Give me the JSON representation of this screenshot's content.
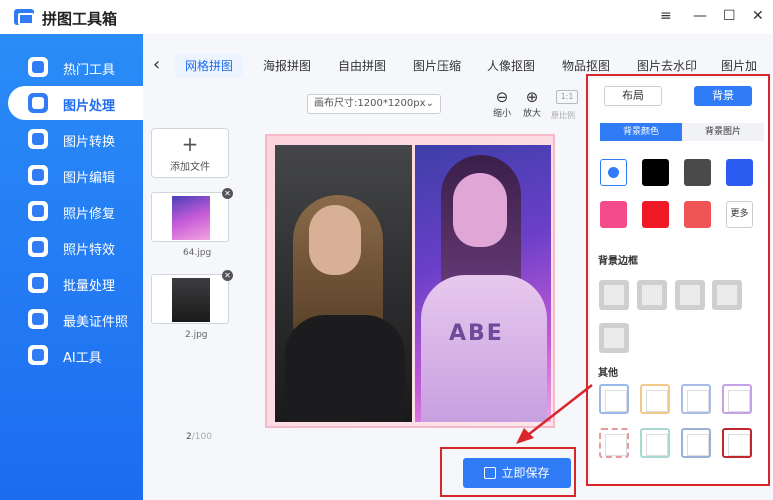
{
  "app": {
    "title": "拼图工具箱",
    "window_controls": [
      "≡",
      "—",
      "☐",
      "✕"
    ]
  },
  "sidebar": {
    "items": [
      {
        "label": "热门工具",
        "icon": "wrench-icon"
      },
      {
        "label": "图片处理",
        "icon": "image-edit-icon",
        "active": true
      },
      {
        "label": "图片转换",
        "icon": "image-convert-icon"
      },
      {
        "label": "图片编辑",
        "icon": "image-pencil-icon"
      },
      {
        "label": "照片修复",
        "icon": "photo-repair-icon"
      },
      {
        "label": "照片特效",
        "icon": "photo-effect-icon"
      },
      {
        "label": "批量处理",
        "icon": "batch-icon"
      },
      {
        "label": "最美证件照",
        "icon": "id-photo-icon"
      },
      {
        "label": "AI工具",
        "icon": "ai-icon"
      }
    ]
  },
  "tabs": [
    "网格拼图",
    "海报拼图",
    "自由拼图",
    "图片压缩",
    "人像抠图",
    "物品抠图",
    "图片去水印",
    "图片加水"
  ],
  "toolbar": {
    "canvas_size": "画布尺寸:1200*1200px",
    "zoom_out": "缩小",
    "zoom_in": "放大",
    "ratio_icon": "1:1",
    "ratio_label": "原比例"
  },
  "files": {
    "add_label": "添加文件",
    "items": [
      {
        "name": "64.jpg"
      },
      {
        "name": "2.jpg"
      }
    ],
    "count_current": "2",
    "count_total": "/100"
  },
  "actions": {
    "save_label": "立即保存"
  },
  "panel": {
    "toggle_layout": "布局",
    "toggle_background": "背景",
    "subtab_color": "背景颜色",
    "subtab_image": "背景图片",
    "colors": [
      "selected",
      "#000000",
      "#4a4a4a",
      "#2b5cf2",
      "#f44b8a",
      "#f01928",
      "#ef5555"
    ],
    "more_label": "更多",
    "border_title": "背景边框",
    "other_title": "其他"
  }
}
